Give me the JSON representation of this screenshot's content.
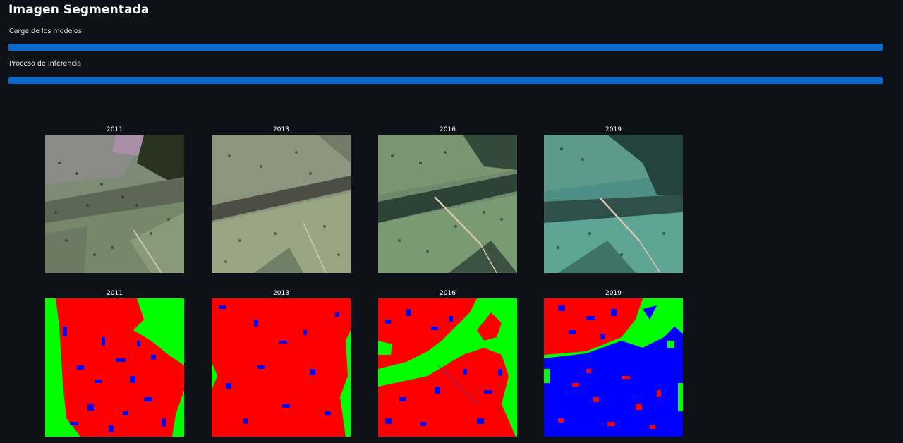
{
  "page": {
    "title": "Imagen Segmentada"
  },
  "progress": [
    {
      "label": "Carga de los modelos",
      "value": 1.0,
      "color": "#0b6bcb"
    },
    {
      "label": "Proceso de Inferencia",
      "value": 1.0,
      "color": "#0b6bcb"
    }
  ],
  "figure": {
    "satellite_titles": [
      "2011",
      "2013",
      "2016",
      "2019"
    ],
    "segmentation_titles": [
      "2011",
      "2013",
      "2016",
      "2019"
    ],
    "class_colors": {
      "class_a": "#ff0000",
      "class_b": "#0000ff",
      "class_c": "#00ff00"
    }
  }
}
